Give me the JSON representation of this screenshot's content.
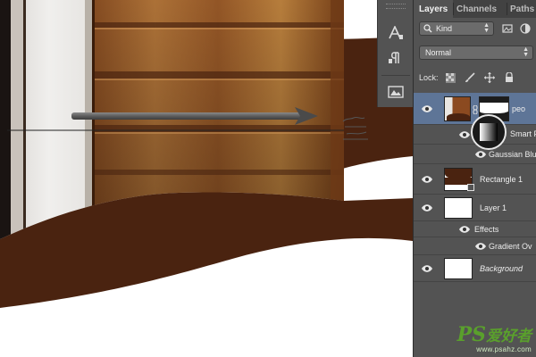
{
  "tool_strip": {
    "tools": [
      {
        "icon": "character-icon"
      },
      {
        "icon": "paragraph-icon"
      },
      {
        "icon": "image-adjust-icon"
      }
    ]
  },
  "layers_panel": {
    "tabs": [
      {
        "label": "Layers",
        "active": true
      },
      {
        "label": "Channels",
        "active": false
      },
      {
        "label": "Paths",
        "active": false
      }
    ],
    "filter": {
      "kind_label": "Kind"
    },
    "blend_mode": "Normal",
    "lock_label": "Lock:",
    "layers": [
      {
        "name": "peo",
        "selected": true,
        "linked_mask": true
      },
      {
        "name": "Smart F",
        "sub": true
      },
      {
        "name": "Gaussian Blu",
        "sub": true
      },
      {
        "name": "Rectangle 1"
      },
      {
        "name": "Layer 1"
      },
      {
        "name": "Effects",
        "sub": true
      },
      {
        "name": "Gradient Ov",
        "sub": true
      },
      {
        "name": "Background",
        "italic": true
      }
    ]
  },
  "canvas": {
    "colors": {
      "brown": "#4a2310",
      "wood_light": "#b0743a",
      "wood_dark": "#5a2f12",
      "arrow": "#5a5a5a"
    }
  },
  "watermark": {
    "brand": "PS",
    "chinese": "爱好者",
    "url": "www.psahz.com"
  },
  "colors": {
    "panel_bg": "#535353",
    "tab_bar": "#424242",
    "selection": "#5e7597",
    "watermark_green": "#5aa02c"
  }
}
